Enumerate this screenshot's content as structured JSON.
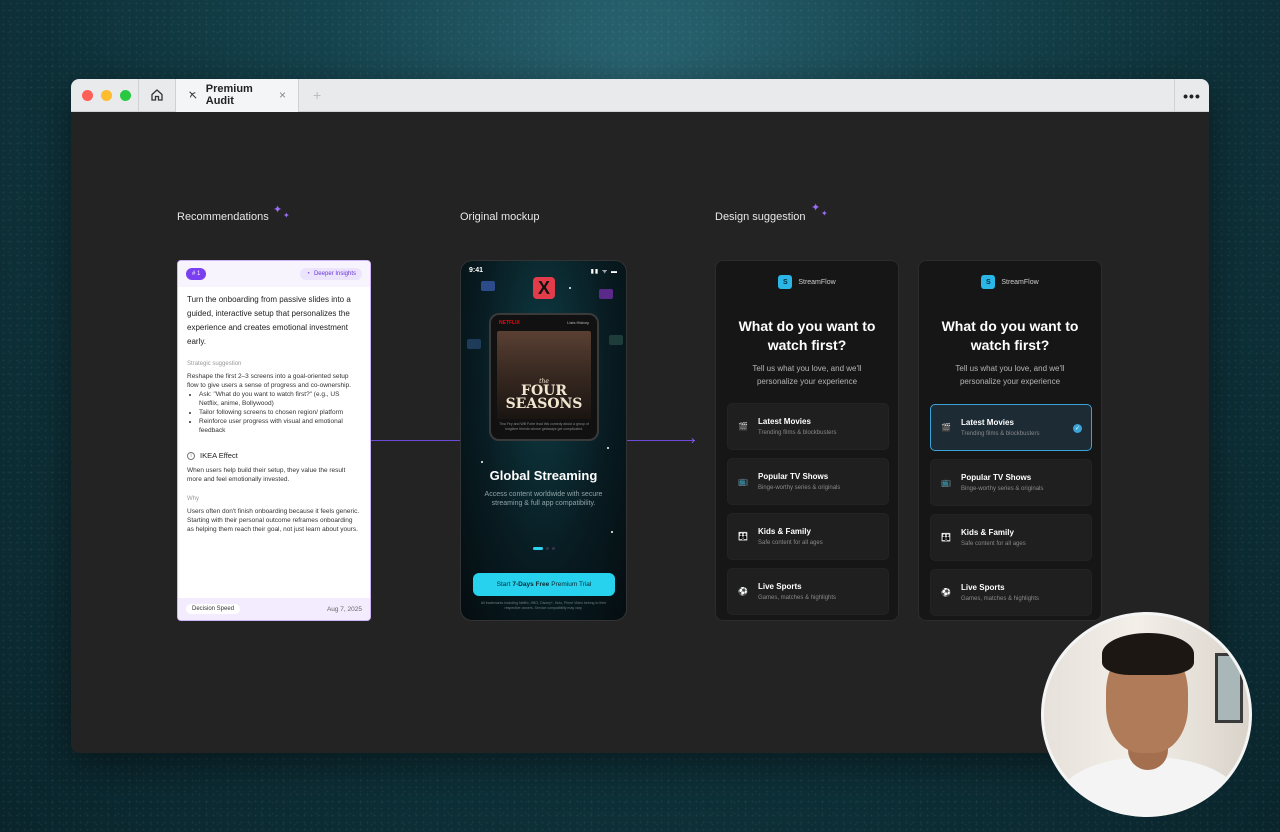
{
  "browser": {
    "tab_title": "Premium Audit",
    "tab_close": "×",
    "new_tab": "+",
    "menu": "•••"
  },
  "sections": {
    "recommendations": "Recommendations",
    "original": "Original mockup",
    "design": "Design suggestion"
  },
  "recommendation": {
    "rank": "# 1",
    "badge": "Deeper Insights",
    "headline": "Turn the onboarding from passive slides into a guided, interactive setup that personalizes the experience and creates emotional investment early.",
    "strategic_label": "Strategic suggestion",
    "strategic_text": "Reshape the first 2–3 screens into a goal-oriented setup flow to give users a sense of progress and co-ownership.",
    "bullets": [
      "Ask: \"What do you want to watch first?\" (e.g., US Netflix, anime, Bollywood)",
      "Tailor following screens to chosen region/ platform",
      "Reinforce user progress with visual and emotional feedback"
    ],
    "effect_icon": "i",
    "effect_title": "IKEA Effect",
    "effect_text": "When users help build their setup, they value the result more and feel emotionally invested.",
    "why_label": "Why",
    "why_text": "Users often don't finish onboarding because it feels generic. Starting with their personal outcome reframes onboarding as helping them reach their goal, not just learn about yours.",
    "footer_tag": "Decision Speed",
    "footer_date": "Aug 7, 2025"
  },
  "mockup": {
    "time": "9:41",
    "status": "▮▮ ᯤ ▬",
    "logo_mark": "X",
    "nav_brand": "NETFLIX",
    "nav_links": "Lists   History",
    "poster_title_top": "the",
    "poster_title": "FOUR SEASONS",
    "poster_caption": "Tina Fey and Will Forte lead this comedy about a group of longtime friends whose getaways get complicated.",
    "headline": "Global Streaming",
    "subtext": "Access content worldwide with secure streaming & full app compatibility.",
    "cta_prefix": "Start",
    "cta_bold": "7-Days Free",
    "cta_suffix": "Premium Trial",
    "fine_print": "All trademarks including Netflix, HBO, Disney+, Hulu, Prime Video belong to their respective owners. Service compatibility may vary."
  },
  "suggestion_cards": [
    {
      "brand_mark": "S",
      "brand": "StreamFlow",
      "title": "What do you want to watch first?",
      "subtitle": "Tell us what you love, and we'll personalize your experience",
      "options": [
        {
          "icon": "🎬",
          "title": "Latest Movies",
          "desc": "Trending films & blockbusters",
          "selected": false
        },
        {
          "icon": "📺",
          "title": "Popular TV Shows",
          "desc": "Binge-worthy series & originals",
          "selected": false
        },
        {
          "icon": "👪",
          "title": "Kids & Family",
          "desc": "Safe content for all ages",
          "selected": false
        },
        {
          "icon": "⚽",
          "title": "Live Sports",
          "desc": "Games, matches & highlights",
          "selected": false
        }
      ]
    },
    {
      "brand_mark": "S",
      "brand": "StreamFlow",
      "title": "What do you want to watch first?",
      "subtitle": "Tell us what you love, and we'll personalize your experience",
      "options": [
        {
          "icon": "🎬",
          "title": "Latest Movies",
          "desc": "Trending films & blockbusters",
          "selected": true
        },
        {
          "icon": "📺",
          "title": "Popular TV Shows",
          "desc": "Binge-worthy series & originals",
          "selected": false
        },
        {
          "icon": "👪",
          "title": "Kids & Family",
          "desc": "Safe content for all ages",
          "selected": false
        },
        {
          "icon": "⚽",
          "title": "Live Sports",
          "desc": "Games, matches & highlights",
          "selected": false
        }
      ]
    }
  ],
  "check_mark": "✓",
  "colors": {
    "accent_purple": "#7a3ff0",
    "cta_cyan": "#26d2ee",
    "select_blue": "#3aa3d8"
  }
}
